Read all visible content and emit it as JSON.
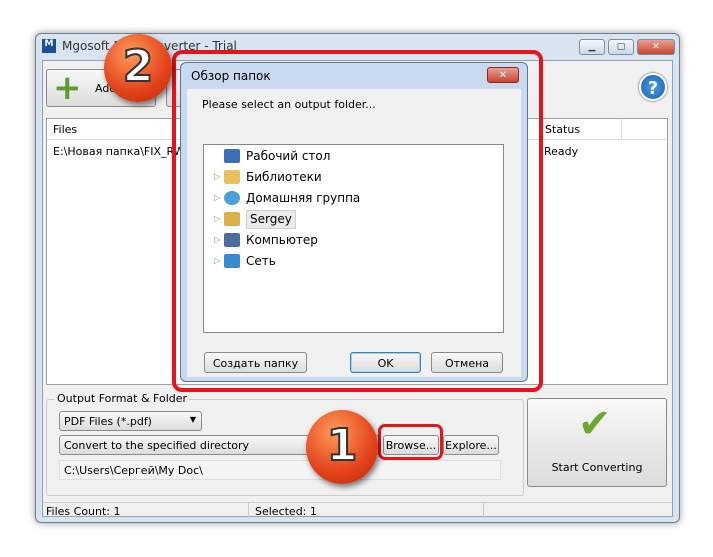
{
  "window": {
    "title": "Mgosoft PDF Converter - Trial",
    "minimize": "▁",
    "maximize": "▢",
    "close": "✕"
  },
  "toolbar": {
    "add_label": "Add",
    "help": "?"
  },
  "file_list": {
    "columns": [
      "Files",
      "Status"
    ],
    "rows": [
      {
        "file": "E:\\Новая папка\\FIX_RW_",
        "status": "Ready"
      }
    ]
  },
  "output": {
    "group_label": "Output Format & Folder",
    "format": "PDF Files (*.pdf)",
    "mode": "Convert to the specified directory",
    "browse": "Browse...",
    "explore": "Explore...",
    "path": "C:\\Users\\Сергей\\My Doc\\",
    "start": "Start Converting"
  },
  "status_bar": {
    "files_count": "Files Count: 1",
    "selected": "Selected: 1"
  },
  "dialog": {
    "title": "Обзор папок",
    "prompt": "Please select an output folder...",
    "tree": [
      "Рабочий стол",
      "Библиотеки",
      "Домашняя группа",
      "Sergey",
      "Компьютер",
      "Сеть"
    ],
    "new_folder": "Создать папку",
    "ok": "OK",
    "cancel": "Отмена"
  },
  "badges": [
    "1",
    "2"
  ],
  "colors": {
    "highlight": "#e4141b",
    "badge": "#e2421a"
  }
}
